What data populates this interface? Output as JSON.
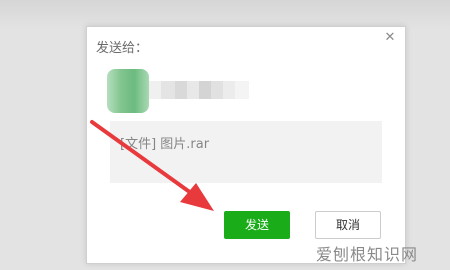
{
  "dialog": {
    "title": "发送给：",
    "close_icon": "close-icon",
    "message_text": "[文件] 图片.rar",
    "send_label": "发送",
    "cancel_label": "取消"
  },
  "colors": {
    "send_button": "#1aad19",
    "annotation_arrow": "#e8393c"
  },
  "watermark": "爱刨根知识网"
}
